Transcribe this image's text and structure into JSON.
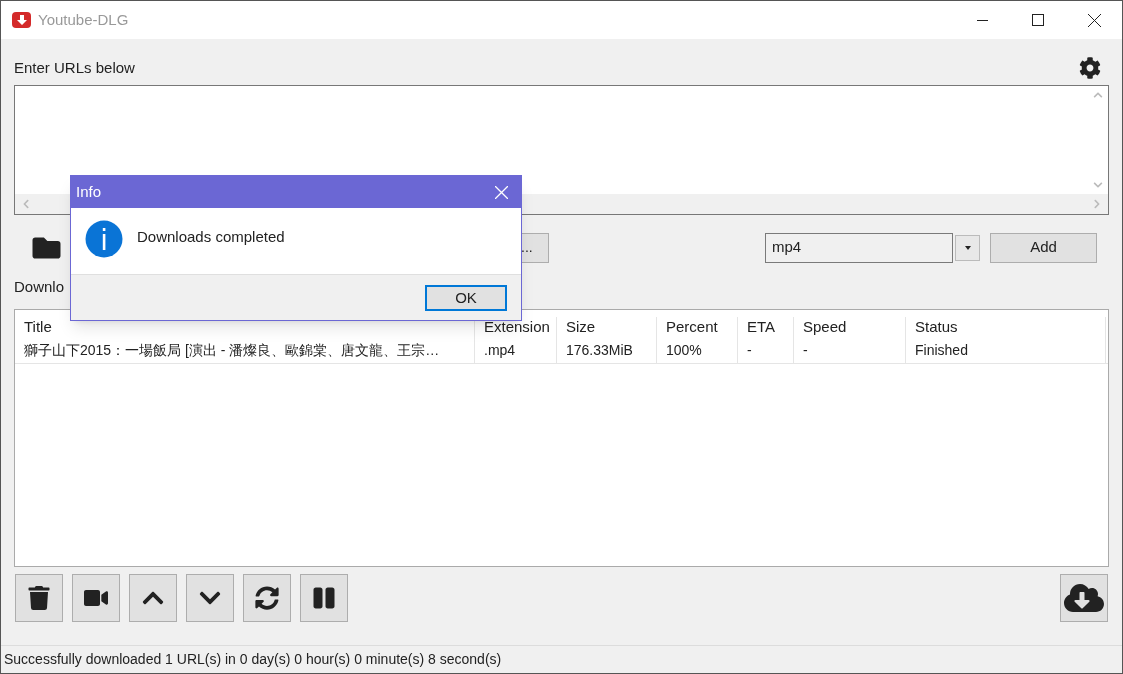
{
  "window": {
    "title": "Youtube-DLG"
  },
  "url_label": "Enter URLs below",
  "path_button": "...",
  "format": {
    "value": "mp4"
  },
  "add_button": "Add",
  "downloads_label": "Downlo",
  "table": {
    "columns": [
      "Title",
      "Extension",
      "Size",
      "Percent",
      "ETA",
      "Speed",
      "Status"
    ],
    "rows": [
      [
        "獅子山下2015：一場飯局 [演出 - 潘燦良、歐錦棠、唐文龍、王宗…",
        ".mp4",
        "176.33MiB",
        "100%",
        "-",
        "-",
        "Finished"
      ]
    ]
  },
  "status_bar": "Successfully downloaded 1 URL(s) in 0 day(s) 0 hour(s) 0 minute(s) 8 second(s)",
  "dialog": {
    "title": "Info",
    "message": "Downloads completed",
    "button": "OK"
  }
}
